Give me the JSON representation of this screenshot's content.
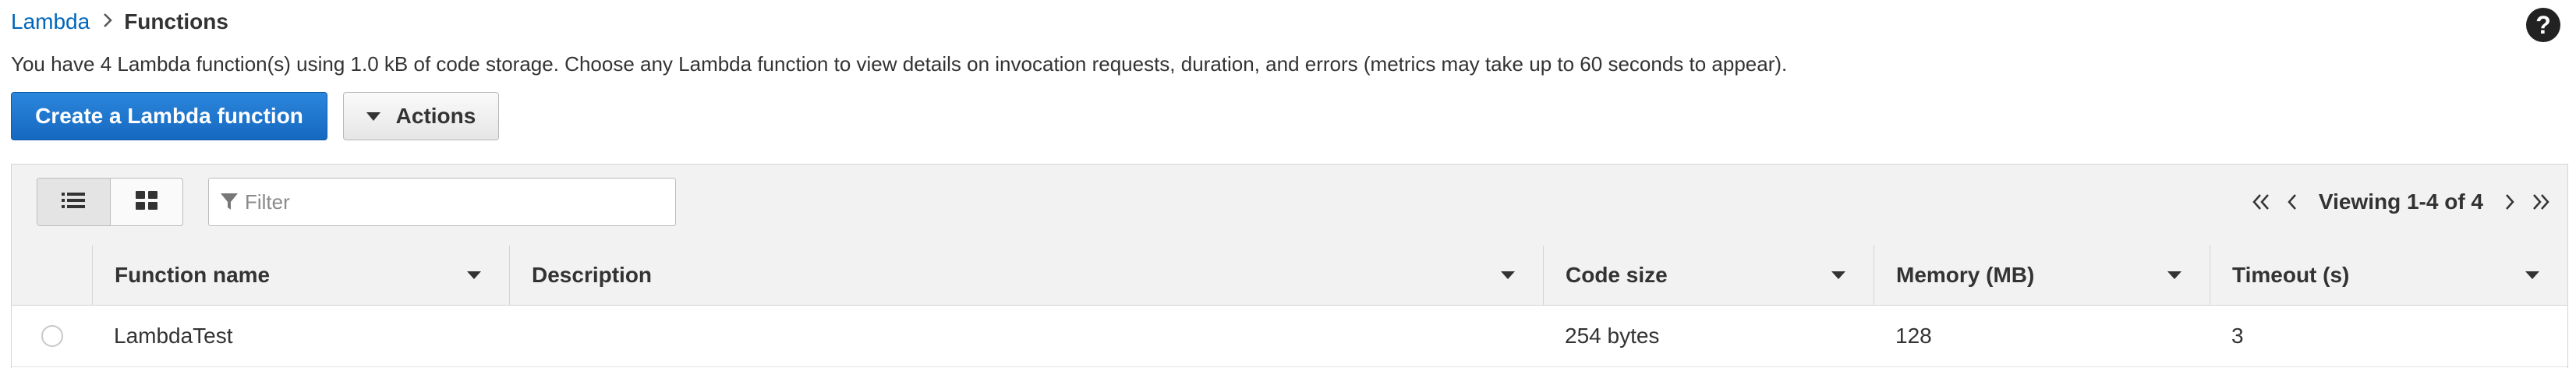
{
  "breadcrumb": {
    "root": "Lambda",
    "separator": "›",
    "current": "Functions"
  },
  "help": {
    "icon": "help-icon",
    "label": "?"
  },
  "summary": "You have 4 Lambda function(s) using 1.0 kB of code storage. Choose any Lambda function to view details on invocation requests, duration, and errors (metrics may take up to 60 seconds to appear).",
  "actions": {
    "create_label": "Create a Lambda function",
    "actions_label": "Actions"
  },
  "toolbar": {
    "view_modes": [
      "list-view-icon",
      "grid-view-icon"
    ],
    "active_view": "list",
    "filter_placeholder": "Filter",
    "filter_value": "",
    "pager_text": "Viewing 1-4 of 4"
  },
  "table": {
    "columns": [
      "Function name",
      "Description",
      "Code size",
      "Memory (MB)",
      "Timeout (s)"
    ],
    "rows": [
      {
        "selected": false,
        "function_name": "LambdaTest",
        "description": "",
        "code_size": "254 bytes",
        "memory": "128",
        "timeout": "3"
      }
    ]
  },
  "colors": {
    "link": "#0066bb",
    "primary_button": "#1f76d2",
    "header_bg": "#f2f2f2",
    "border": "#d5d5d5",
    "text": "#333333"
  }
}
